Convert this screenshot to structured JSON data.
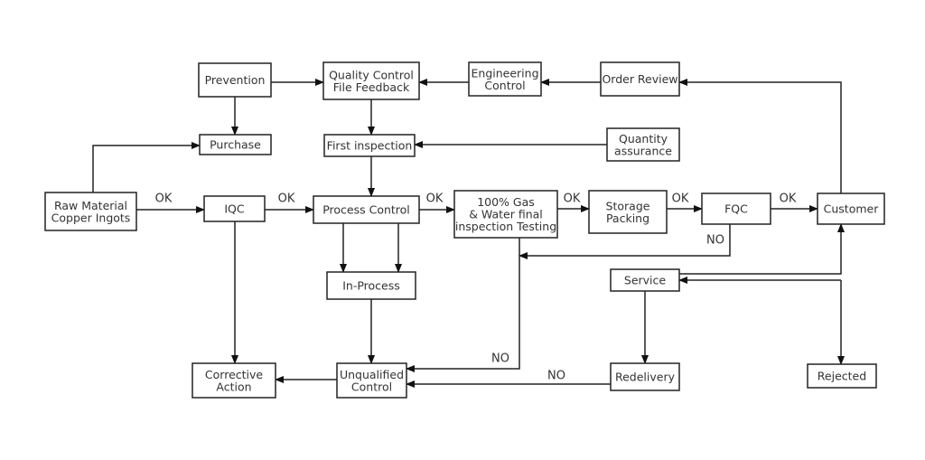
{
  "nodes": {
    "prevention": [
      "Prevention"
    ],
    "qc_feedback": [
      "Quality Control",
      "File Feedback"
    ],
    "engineering": [
      "Engineering",
      "Control"
    ],
    "order_review": [
      "Order Review"
    ],
    "purchase": [
      "Purchase"
    ],
    "first_inspection": [
      "First inspection"
    ],
    "quantity_assurance": [
      "Quantity",
      "assurance"
    ],
    "raw_material": [
      "Raw Material",
      "Copper Ingots"
    ],
    "iqc": [
      "IQC"
    ],
    "process_control": [
      "Process Control"
    ],
    "final_testing": [
      "100% Gas",
      "& Water final",
      "inspection Testing"
    ],
    "storage": [
      "Storage",
      "Packing"
    ],
    "fqc": [
      "FQC"
    ],
    "customer": [
      "Customer"
    ],
    "in_process": [
      "In-Process"
    ],
    "service": [
      "Service"
    ],
    "corrective": [
      "Corrective",
      "Action"
    ],
    "unqualified": [
      "Unqualified",
      "Control"
    ],
    "redelivery": [
      "Redelivery"
    ],
    "rejected": [
      "Rejected"
    ]
  },
  "edge_labels": {
    "ok": "OK",
    "no": "NO"
  }
}
